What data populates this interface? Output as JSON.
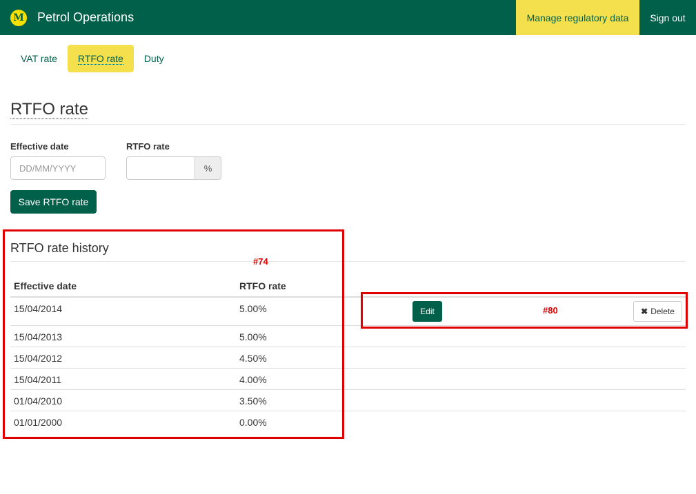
{
  "header": {
    "logo_letter": "M",
    "app_title": "Petrol Operations",
    "manage_link": "Manage regulatory data",
    "signout_link": "Sign out",
    "brand_color": "#00604a",
    "accent_color": "#f4e04d"
  },
  "tabs": [
    {
      "label": "VAT rate",
      "active": false
    },
    {
      "label": "RTFO rate",
      "active": true
    },
    {
      "label": "Duty",
      "active": false
    }
  ],
  "page_title": "RTFO rate",
  "form": {
    "effective_date_label": "Effective date",
    "effective_date_placeholder": "DD/MM/YYYY",
    "rate_label": "RTFO rate",
    "rate_value": "",
    "rate_addon": "%",
    "save_label": "Save RTFO rate"
  },
  "history": {
    "title": "RTFO rate history",
    "columns": [
      "Effective date",
      "RTFO rate"
    ],
    "rows": [
      {
        "date": "15/04/2014",
        "rate": "5.00%"
      },
      {
        "date": "15/04/2013",
        "rate": "5.00%"
      },
      {
        "date": "15/04/2012",
        "rate": "4.50%"
      },
      {
        "date": "15/04/2011",
        "rate": "4.00%"
      },
      {
        "date": "01/04/2010",
        "rate": "3.50%"
      },
      {
        "date": "01/01/2000",
        "rate": "0.00%"
      }
    ],
    "edit_label": "Edit",
    "delete_label": "Delete",
    "delete_icon": "✖"
  },
  "annotations": {
    "label_74": "#74",
    "label_80": "#80",
    "color": "#e00000"
  }
}
